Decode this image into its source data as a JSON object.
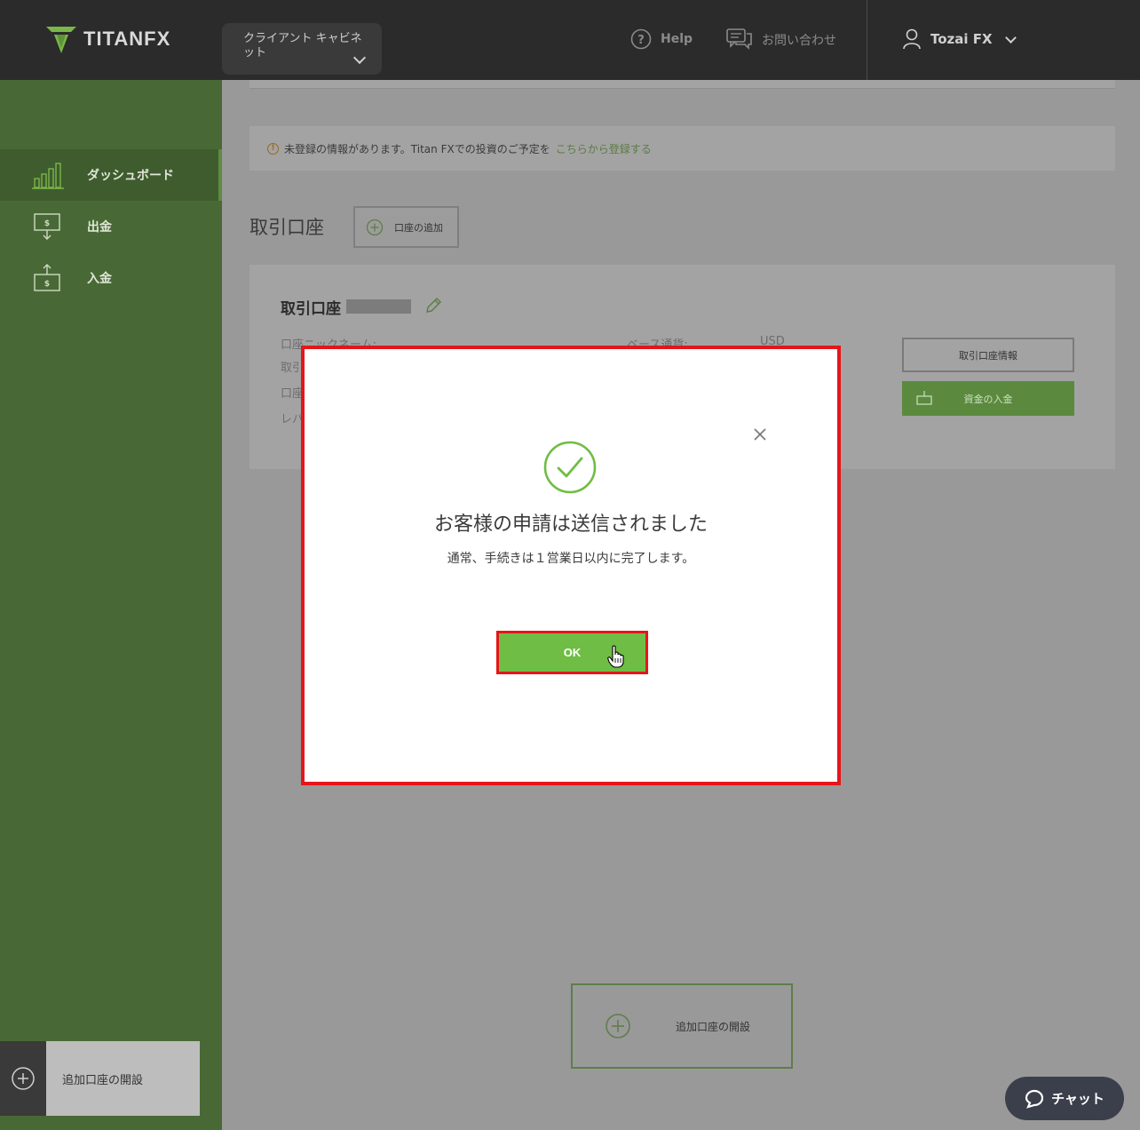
{
  "header": {
    "logo_text": "TITANFX",
    "cabinet_label": "クライアント キャビネット",
    "help_label": "Help",
    "contact_label": "お問い合わせ",
    "user_name": "Tozai FX"
  },
  "sidebar": {
    "items": [
      {
        "label": "ダッシュボード",
        "icon": "bar-chart-icon",
        "active": true
      },
      {
        "label": "出金",
        "icon": "withdraw-icon",
        "active": false
      },
      {
        "label": "入金",
        "icon": "deposit-icon",
        "active": false
      }
    ],
    "add_account_label": "追加口座の開設"
  },
  "main": {
    "notice": {
      "text": "未登録の情報があります。Titan FXでの投資のご予定を",
      "link_text": "こちらから登録する"
    },
    "section_title": "取引口座",
    "add_account_button": "口座の追加",
    "account_card": {
      "title": "取引口座",
      "labels": [
        "口座ニックネーム:",
        "取引",
        "口座",
        "レバ"
      ],
      "base_currency_label": "ベース通貨:",
      "base_currency_value": "USD",
      "info_button": "取引口座情報",
      "deposit_button": "資金の入金"
    },
    "bottom_add_label": "追加口座の開設",
    "chat_label": "チャット"
  },
  "modal": {
    "title": "お客様の申請は送信されました",
    "subtitle": "通常、手続きは１営業日以内に完了します。",
    "ok_label": "OK"
  },
  "colors": {
    "brand_green": "#6fbd44",
    "sidebar_green": "#486935",
    "highlight_red": "#e4161a"
  }
}
